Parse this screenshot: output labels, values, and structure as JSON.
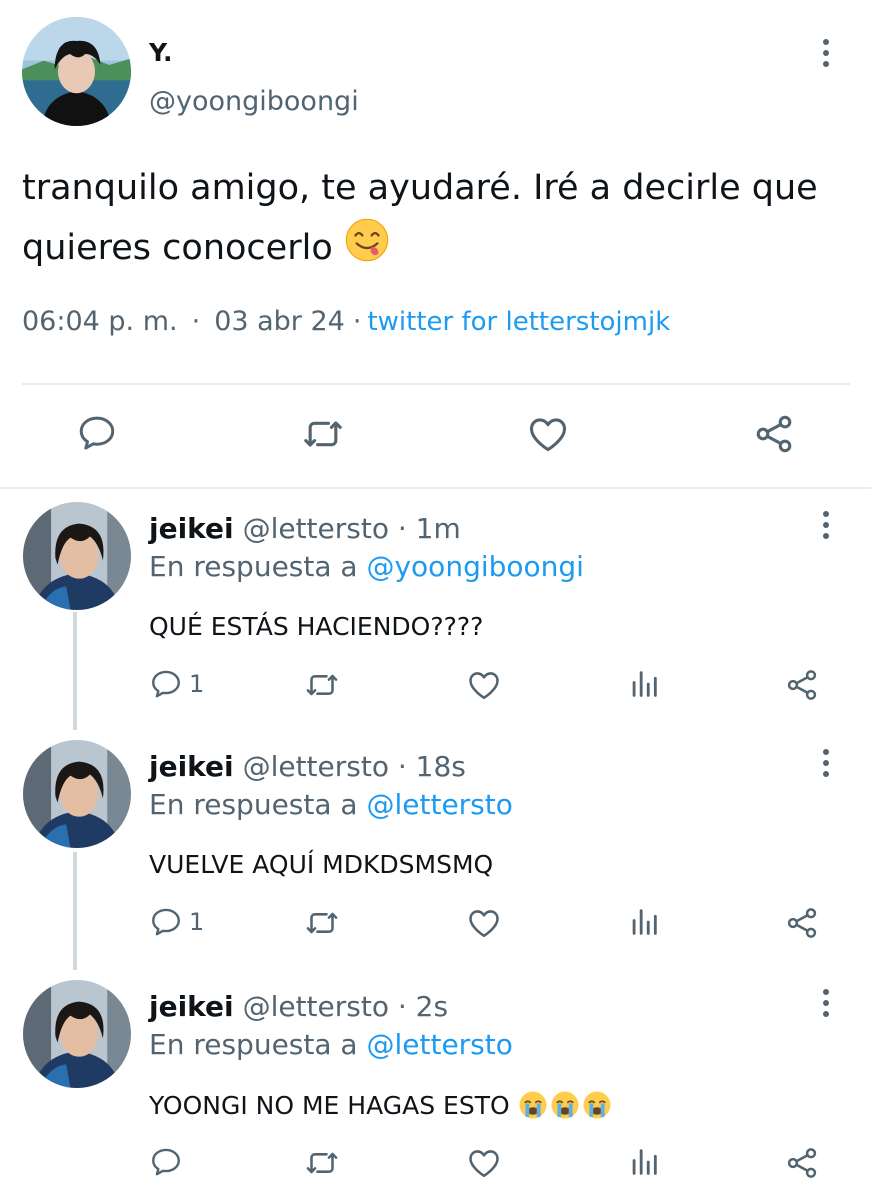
{
  "main_tweet": {
    "author_name": "Y.",
    "handle": "@yoongiboongi",
    "text": "tranquilo amigo, te ayudaré. Iré a decirle que quieres conocerlo",
    "time": "06:04 p. m.",
    "date": "03 abr 24",
    "source": "twitter for letterstojmjk",
    "separator": "·",
    "emoji": "yum-face-emoji"
  },
  "replies": [
    {
      "name": "jeikei",
      "handle": "@lettersto",
      "time_ago": "· 1m",
      "reply_prefix": "En respuesta a",
      "reply_to": "@yoongiboongi",
      "text": "QUÉ ESTÁS HACIENDO????",
      "reply_count": "1"
    },
    {
      "name": "jeikei",
      "handle": "@lettersto",
      "time_ago": "· 18s",
      "reply_prefix": "En respuesta a",
      "reply_to": "@lettersto",
      "text": "VUELVE AQUÍ MDKDSMSMQ",
      "reply_count": "1"
    },
    {
      "name": "jeikei",
      "handle": "@lettersto",
      "time_ago": "· 2s",
      "reply_prefix": "En respuesta a",
      "reply_to": "@lettersto",
      "text": "YOONGI NO ME HAGAS ESTO",
      "reply_count": "",
      "emoji": "crying-face-emoji"
    }
  ],
  "colors": {
    "text": "#0f1419",
    "secondary": "#536471",
    "link": "#1d9bf0",
    "divider": "#e6ecf0",
    "thread_line": "#cfd9de"
  },
  "icons": [
    "reply-icon",
    "retweet-icon",
    "like-icon",
    "share-icon",
    "views-icon",
    "more-icon"
  ]
}
